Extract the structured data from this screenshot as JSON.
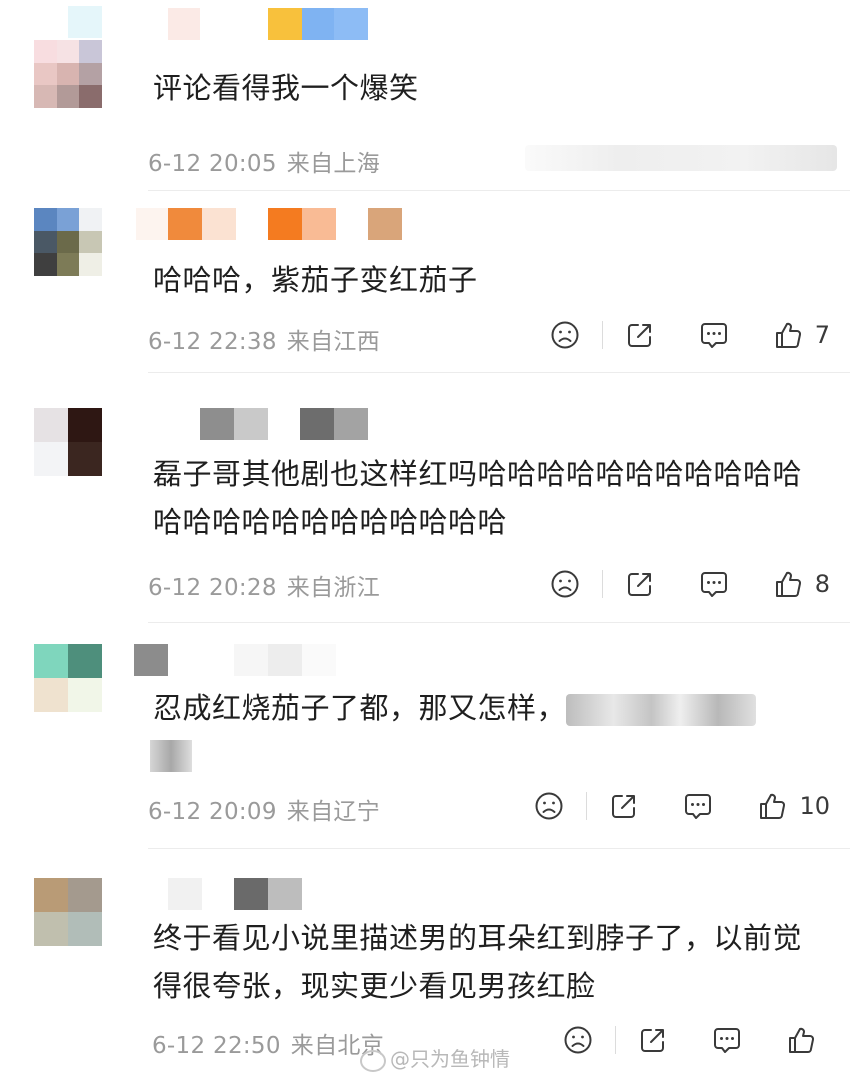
{
  "comments": [
    {
      "text": "评论看得我一个爆笑",
      "date": "6-12 20:05",
      "location": "来自上海",
      "likes": ""
    },
    {
      "text": "哈哈哈，紫茄子变红茄子",
      "date": "6-12 22:38",
      "location": "来自江西",
      "likes": "7"
    },
    {
      "text": "磊子哥其他剧也这样红吗哈哈哈哈哈哈哈哈哈哈哈哈哈哈哈哈哈哈哈哈哈哈哈",
      "date": "6-12 20:28",
      "location": "来自浙江",
      "likes": "8"
    },
    {
      "text": "忍成红烧茄子了都，那又怎样，",
      "date": "6-12 20:09",
      "location": "来自辽宁",
      "likes": "10"
    },
    {
      "text": "终于看见小说里描述男的耳朵红到脖子了，以前觉得很夸张，现实更少看见男孩红脸",
      "date": "6-12 22:50",
      "location": "来自北京",
      "likes": ""
    }
  ],
  "watermark": "@只为鱼钟情",
  "icons": {
    "dislike": "frown-face-icon",
    "share": "share-icon",
    "reply": "comment-icon",
    "like": "thumbs-up-icon"
  }
}
